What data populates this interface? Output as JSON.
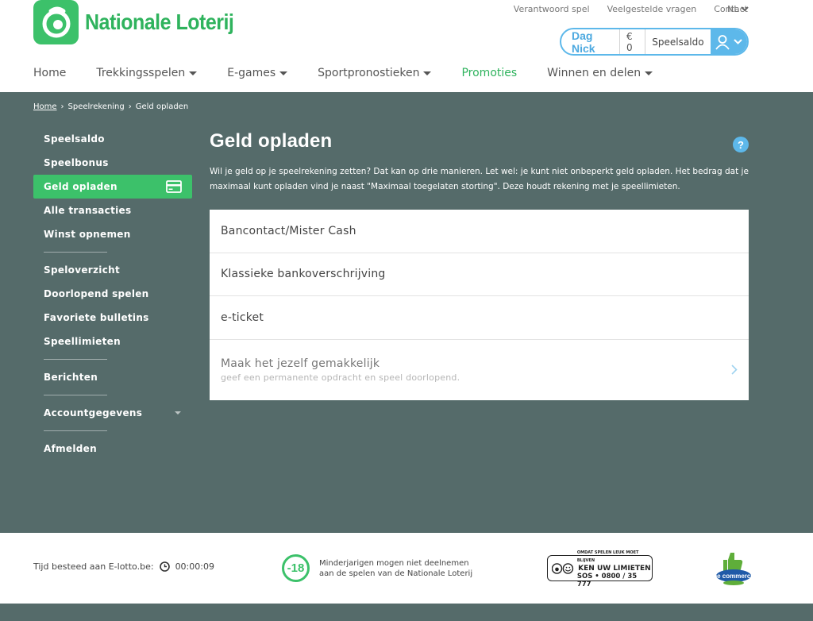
{
  "brand": {
    "name": "Nationale Loterij",
    "color": "#2fb35d"
  },
  "top_links": [
    "Verantwoord spel",
    "Veelgestelde vragen",
    "Contact"
  ],
  "language": "NL",
  "account": {
    "greeting": "Dag Nick",
    "balance": "€ 0",
    "balance_label": "Speelsaldo"
  },
  "nav": [
    {
      "label": "Home",
      "dropdown": false
    },
    {
      "label": "Trekkingsspelen",
      "dropdown": true
    },
    {
      "label": "E-games",
      "dropdown": true
    },
    {
      "label": "Sportpronostieken",
      "dropdown": true
    },
    {
      "label": "Promoties",
      "dropdown": false
    },
    {
      "label": "Winnen en delen",
      "dropdown": true
    }
  ],
  "breadcrumb": [
    "Home",
    "Speelrekening",
    "Geld opladen"
  ],
  "sidebar": {
    "group1": [
      "Speelsaldo",
      "Speelbonus",
      "Geld opladen",
      "Alle transacties",
      "Winst opnemen"
    ],
    "group2": [
      "Speloverzicht",
      "Doorlopend spelen",
      "Favoriete bulletins",
      "Speellimieten"
    ],
    "messages": "Berichten",
    "account": "Accountgegevens",
    "logout": "Afmelden"
  },
  "content": {
    "title": "Geld opladen",
    "intro": "Wil je geld op je speelrekening zetten? Dat kan op drie manieren. Let wel: je kunt niet onbeperkt geld opladen. Het bedrag dat je maximaal kunt opladen vind je naast \"Maximaal toegelaten storting\". Deze houdt rekening met je speellimieten.",
    "options": [
      "Bancontact/Mister Cash",
      "Klassieke bankoverschrijving",
      "e-ticket"
    ],
    "easy_title": "Maak het jezelf gemakkelijk",
    "easy_sub": "geef een permanente opdracht en speel doorlopend."
  },
  "footer": {
    "timer_label": "Tijd besteed aan E-lotto.be:",
    "timer_value": "00:00:09",
    "age_badge": "-18",
    "age_line1": "Minderjarigen mogen niet deelnemen",
    "age_line2": "aan de spelen van de Nationale Loterij",
    "kul_small": "OMDAT SPELEN LEUK MOET BLIJVEN",
    "kul_big": "KEN UW LIMIETEN",
    "kul_sos": "SOS • 0800 / 35 777",
    "becommerce": "be commerce"
  }
}
